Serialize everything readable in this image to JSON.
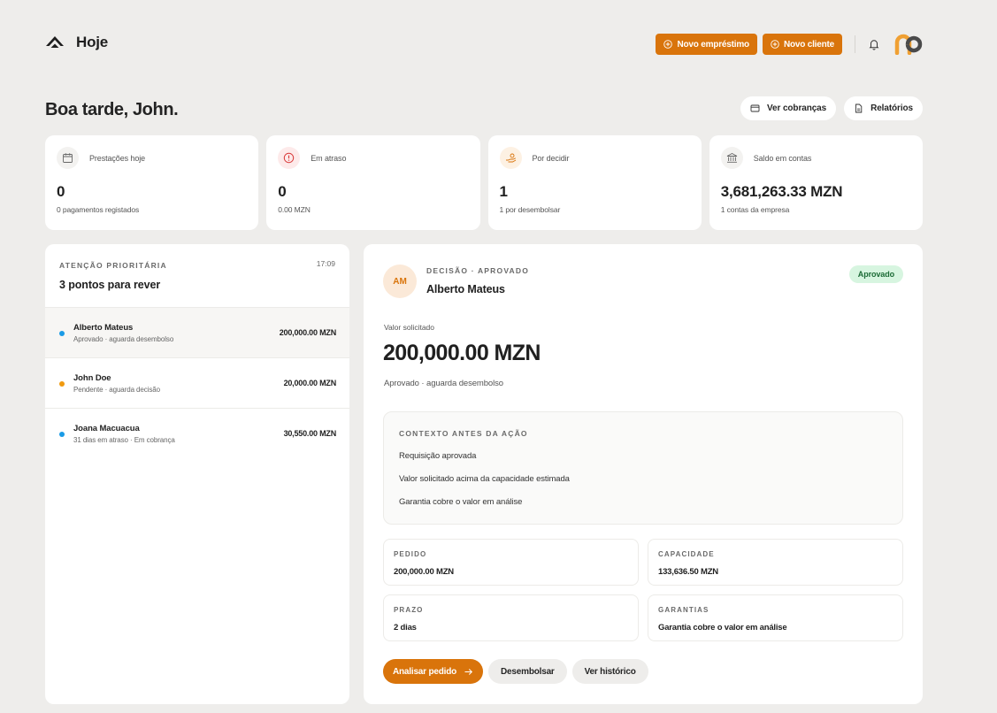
{
  "header": {
    "title": "Hoje",
    "new_loan_label": "Novo empréstimo",
    "new_client_label": "Novo cliente"
  },
  "greeting": {
    "text": "Boa tarde, John.",
    "view_charges_label": "Ver cobranças",
    "reports_label": "Relatórios"
  },
  "stats": [
    {
      "label": "Prestações hoje",
      "value": "0",
      "sub": "0 pagamentos registados",
      "icon": "calendar-icon"
    },
    {
      "label": "Em atraso",
      "value": "0",
      "sub": "0.00 MZN",
      "icon": "alert-icon"
    },
    {
      "label": "Por decidir",
      "value": "1",
      "sub": "1 por desembolsar",
      "icon": "hand-coin-icon"
    },
    {
      "label": "Saldo em contas",
      "value": "3,681,263.33 MZN",
      "sub": "1 contas da empresa",
      "icon": "bank-icon"
    }
  ],
  "priority": {
    "kicker": "ATENÇÃO PRIORITÁRIA",
    "time": "17:09",
    "title": "3 pontos para rever",
    "items": [
      {
        "name": "Alberto Mateus",
        "status": "Aprovado · aguarda desembolso",
        "amount": "200,000.00 MZN",
        "dot_color": "#1a9be6"
      },
      {
        "name": "John Doe",
        "status": "Pendente · aguarda decisão",
        "amount": "20,000.00 MZN",
        "dot_color": "#f09a0f"
      },
      {
        "name": "Joana Macuacua",
        "status": "31 dias em atraso · Em cobrança",
        "amount": "30,550.00 MZN",
        "dot_color": "#1a9be6"
      }
    ]
  },
  "decision": {
    "initials": "AM",
    "kicker": "DECISÃO · APROVADO",
    "name": "Alberto Mateus",
    "badge": "Aprovado",
    "requested_label": "Valor solicitado",
    "requested_amount": "200,000.00 MZN",
    "status": "Aprovado · aguarda desembolso",
    "context": {
      "kicker": "CONTEXTO ANTES DA AÇÃO",
      "items": [
        "Requisição aprovada",
        "Valor solicitado acima da capacidade estimada",
        "Garantia cobre o valor em análise"
      ]
    },
    "facts": [
      {
        "label": "PEDIDO",
        "value": "200,000.00 MZN"
      },
      {
        "label": "CAPACIDADE",
        "value": "133,636.50 MZN"
      },
      {
        "label": "PRAZO",
        "value": "2 dias"
      },
      {
        "label": "GARANTIAS",
        "value": "Garantia cobre o valor em análise"
      }
    ],
    "actions": {
      "analyze_label": "Analisar pedido",
      "disburse_label": "Desembolsar",
      "history_label": "Ver histórico"
    }
  },
  "colors": {
    "accent": "#d9740b",
    "approved_bg": "#d7f5e0",
    "approved_text": "#1c6b36",
    "background": "#eeedeb"
  }
}
